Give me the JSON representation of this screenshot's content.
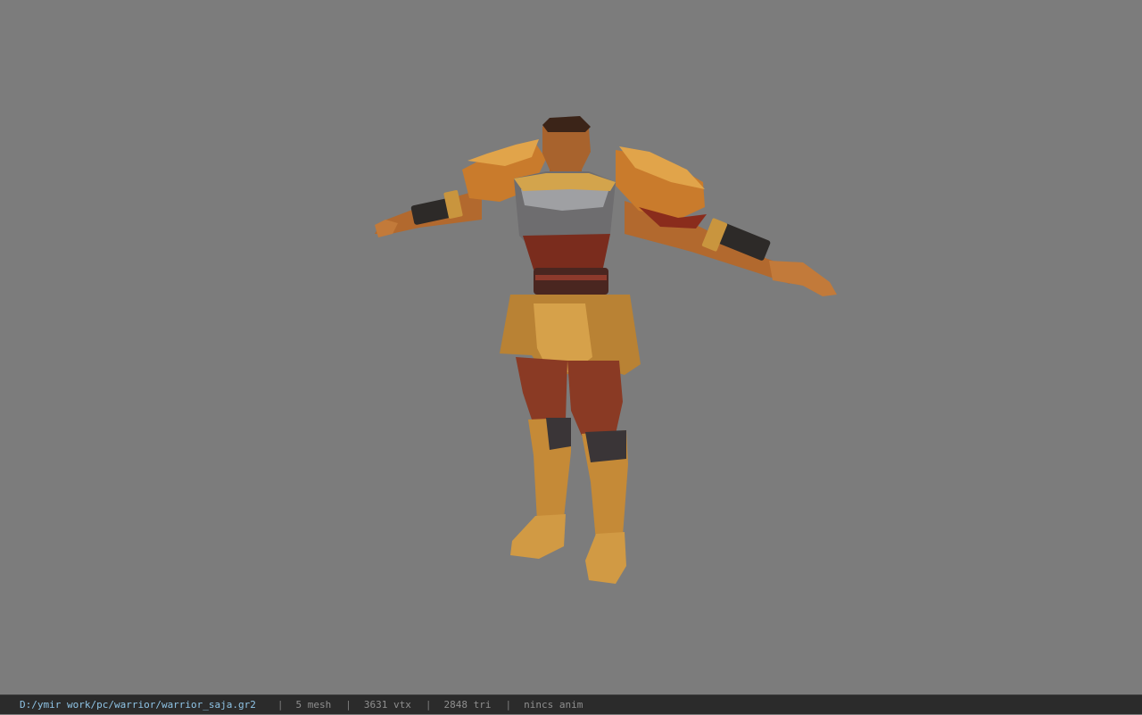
{
  "viewer": {
    "model_subject": "warrior character t-pose",
    "background_color": "#7c7c7c"
  },
  "statusbar": {
    "file_path": "D:/ymir work/pc/warrior/warrior_saja.gr2",
    "separator": "|",
    "mesh_count": "5 mesh",
    "vertex_count": "3631 vtx",
    "triangle_count": "2848 tri",
    "animation": "nincs anim"
  }
}
